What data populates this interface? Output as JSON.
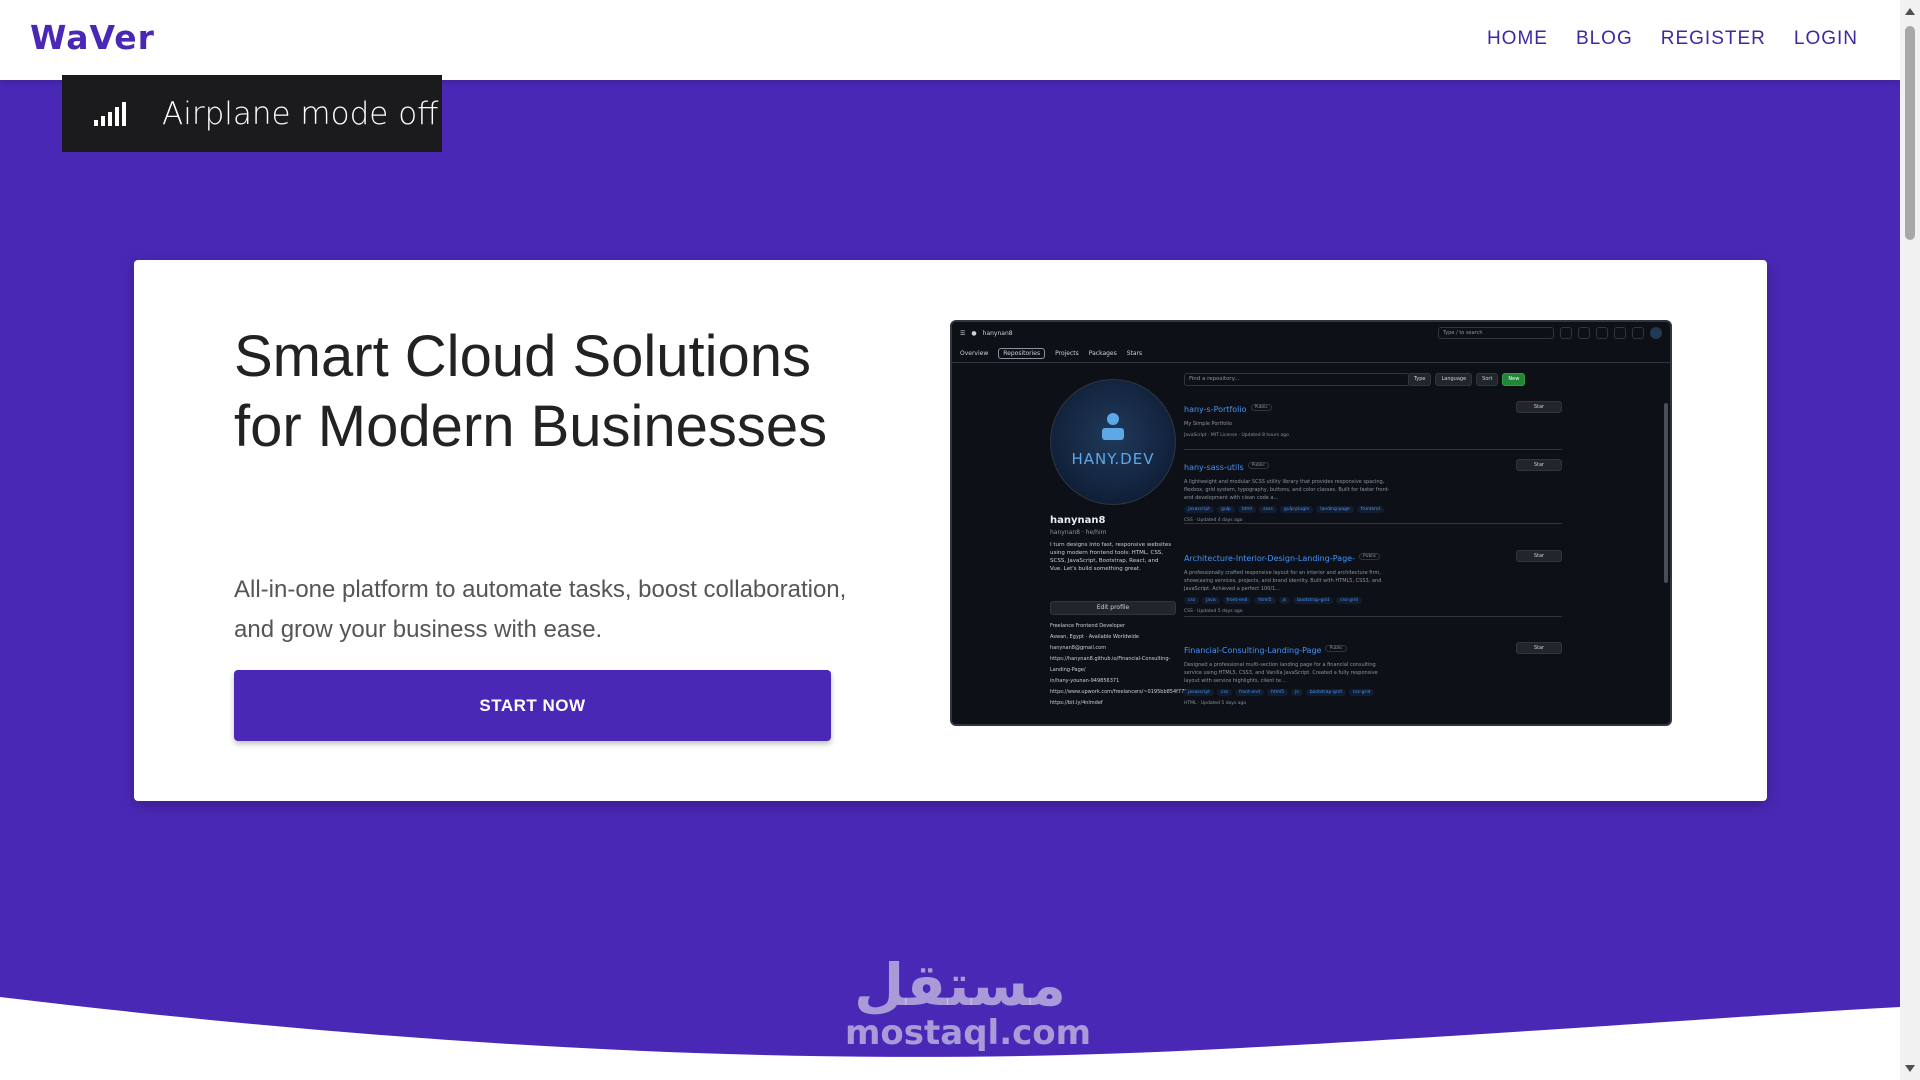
{
  "brand": {
    "logo": "WaVer",
    "color": "#4a28b6"
  },
  "nav": {
    "items": [
      "HOME",
      "BLOG",
      "REGISTER",
      "LOGIN"
    ]
  },
  "toast": {
    "icon": "signal-bars-icon",
    "text": "Airplane mode off"
  },
  "hero": {
    "title": "Smart Cloud Solutions for Modern Businesses",
    "subtitle": "All-in-one platform to automate tasks, boost collaboration, and grow your business with ease.",
    "cta_label": "START NOW"
  },
  "screenshot": {
    "top_user": "hanynan8",
    "search_placeholder": "Type / to search",
    "tabs": [
      "Overview",
      "Repositories",
      "Projects",
      "Packages",
      "Stars"
    ],
    "avatar_text": "HANY.DEV",
    "username": "hanynan8",
    "handle": "hanynan8 · he/him",
    "bio": "I turn designs into fast, responsive websites using modern frontend tools: HTML, CSS, SCSS, JavaScript, Bootstrap, React, and Vue. Let's build something great.",
    "edit_label": "Edit profile",
    "meta": [
      "Freelance Frontend Developer",
      "Aswan, Egypt · Available Worldwide",
      "hanynan8@gmail.com",
      "https://hanynan8.github.io/Financial-Consulting-Landing-Page/",
      "in/hany-younan-949856371",
      "https://www.upwork.com/freelancers/~0195bb854f779fded",
      "https://bit.ly/4nlmdef"
    ],
    "filter_placeholder": "Find a repository...",
    "filter_buttons": [
      "Type",
      "Language",
      "Sort",
      "New"
    ],
    "star_label": "Star",
    "repos": [
      {
        "name": "hany-s-Portfolio",
        "badge": "Public",
        "desc": "My Simple Portfolio",
        "tags": [],
        "footer": "JavaScript · MIT License · Updated 8 hours ago"
      },
      {
        "name": "hany-sass-utils",
        "badge": "Public",
        "desc": "A lightweight and modular SCSS utility library that provides responsive spacing, flexbox, grid system, typography, buttons, and color classes. Built for faster front-end development with clean code a...",
        "tags": [
          "javascript",
          "gulp",
          "html",
          "sass",
          "gulp-plugin",
          "landing-page",
          "frontend"
        ],
        "footer": "CSS · Updated 4 days ago"
      },
      {
        "name": "Architecture-Interior-Design-Landing-Page-",
        "badge": "Public",
        "desc": "A professionally crafted responsive layout for an interior and architecture firm, showcasing services, projects, and brand identity. Built with HTML5, CSS3, and JavaScript. Achieved a perfect 100/1...",
        "tags": [
          "css",
          "java",
          "front-end",
          "html5",
          "js",
          "bootstrap-grid",
          "css-grid"
        ],
        "footer": "CSS · Updated 5 days ago"
      },
      {
        "name": "Financial-Consulting-Landing-Page",
        "badge": "Public",
        "desc": "Designed a professional multi-section landing page for a financial consulting service using HTML5, CSS3, and Vanilla JavaScript. Created a fully responsive layout with service highlights, client te...",
        "tags": [
          "javascript",
          "css",
          "front-end",
          "html5",
          "js",
          "bootstrap-grid",
          "css-grid"
        ],
        "footer": "HTML · Updated 5 days ago"
      }
    ]
  },
  "watermark": {
    "arabic": "مستقل",
    "latin": "mostaql.com"
  }
}
